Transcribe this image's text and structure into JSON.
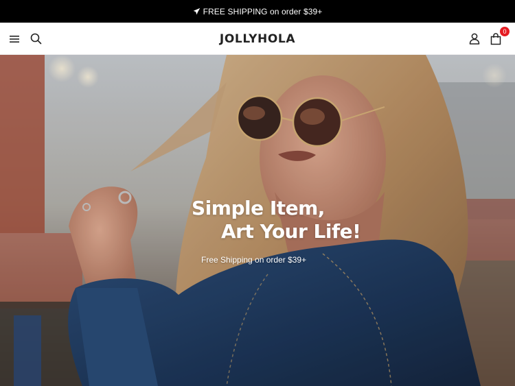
{
  "announcement": {
    "text": "FREE SHIPPING on order $39+",
    "icon": "paper-plane-icon"
  },
  "header": {
    "logo": "JOLLYHOLA",
    "cart_count": "0",
    "icons": [
      "menu-icon",
      "search-icon",
      "user-icon",
      "shopping-bag-icon"
    ]
  },
  "hero": {
    "title_line1": "Simple Item,",
    "title_line2": "Art Your Life!",
    "subtitle": "Free Shipping on order $39+"
  },
  "colors": {
    "announce_bg": "#000000",
    "badge": "#e51c23",
    "logo": "#222222",
    "hero_text": "#ffffff"
  }
}
